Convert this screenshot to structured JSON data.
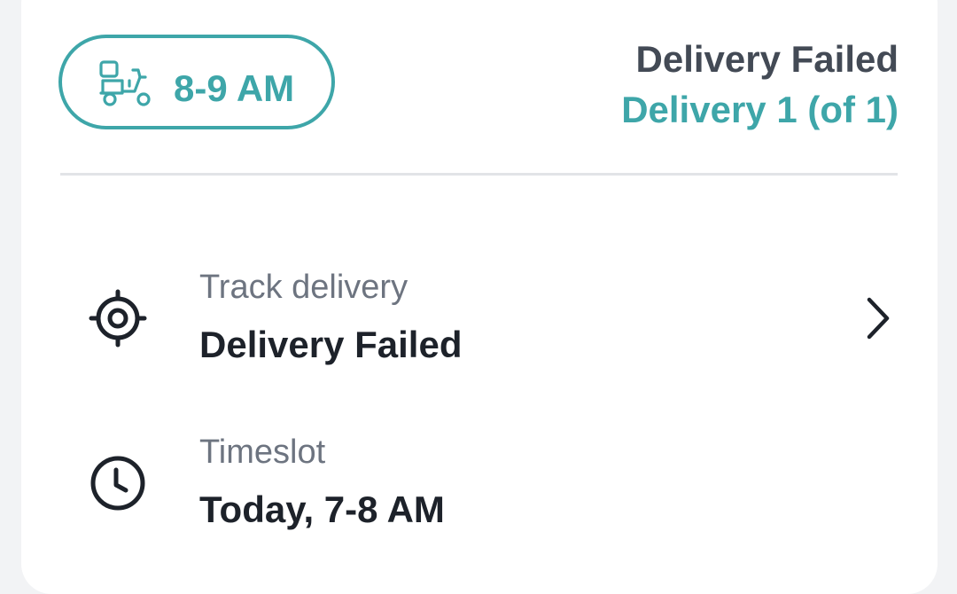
{
  "header": {
    "timeslot_pill": {
      "icon": "delivery-scooter-icon",
      "label": "8-9 AM"
    },
    "status_title": "Delivery Failed",
    "status_subtitle": "Delivery 1 (of 1)"
  },
  "rows": [
    {
      "icon": "location-target-icon",
      "label": "Track delivery",
      "value": "Delivery Failed",
      "has_chevron": true
    },
    {
      "icon": "clock-icon",
      "label": "Timeslot",
      "value": "Today, 7-8 AM",
      "has_chevron": false
    }
  ],
  "colors": {
    "accent": "#3ea6a9",
    "title": "#434a55",
    "label": "#6d7480",
    "value": "#1d222a",
    "divider": "#e2e4e7"
  }
}
